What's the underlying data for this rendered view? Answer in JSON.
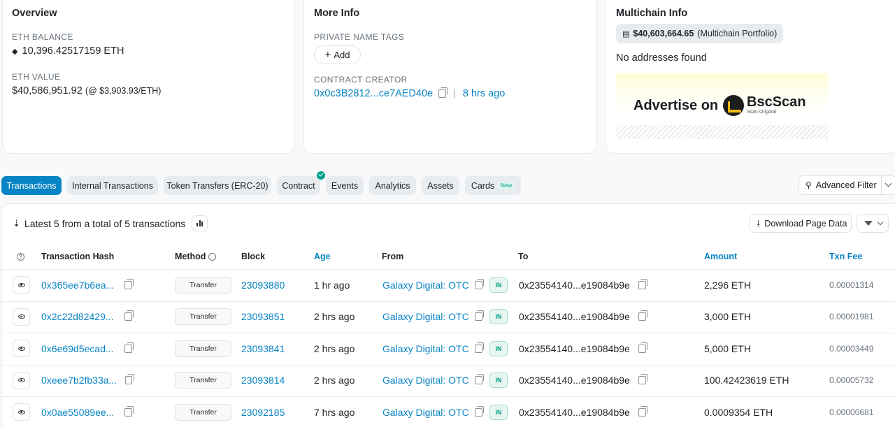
{
  "overview": {
    "title": "Overview",
    "eth_balance_label": "ETH BALANCE",
    "eth_balance": "10,396.42517159 ETH",
    "eth_value_label": "ETH VALUE",
    "eth_value": "$40,586,951.92",
    "eth_value_rate": "(@ $3,903.93/ETH)"
  },
  "more_info": {
    "title": "More Info",
    "name_tags_label": "PRIVATE NAME TAGS",
    "add_label": "Add",
    "contract_creator_label": "CONTRACT CREATOR",
    "creator_address": "0x0c3B2812...ce7AED40e",
    "separator": "|",
    "creator_age": "8 hrs ago"
  },
  "multichain": {
    "title": "Multichain Info",
    "portfolio_value": "$40,603,664.65",
    "portfolio_suffix": "(Multichain Portfolio)",
    "no_addresses": "No addresses found"
  },
  "ad": {
    "text": "Advertise on",
    "brand": "BscScan",
    "brand_sub": "Scan Original"
  },
  "tabs": [
    {
      "label": "Transactions",
      "active": true
    },
    {
      "label": "Internal Transactions"
    },
    {
      "label": "Token Transfers (ERC-20)"
    },
    {
      "label": "Contract"
    },
    {
      "label": "Events"
    },
    {
      "label": "Analytics"
    },
    {
      "label": "Assets"
    },
    {
      "label": "Cards",
      "badge": "New"
    }
  ],
  "advanced_filter_label": "Advanced Filter",
  "table": {
    "summary": "Latest 5 from a total of 5 transactions",
    "download_label": "Download Page Data",
    "headers": {
      "hash": "Transaction Hash",
      "method": "Method",
      "block": "Block",
      "age": "Age",
      "from": "From",
      "to": "To",
      "amount": "Amount",
      "fee": "Txn Fee"
    },
    "rows": [
      {
        "hash": "0x365ee7b6ea...",
        "method": "Transfer",
        "block": "23093880",
        "age": "1 hr ago",
        "from": "Galaxy Digital: OTC",
        "direction": "IN",
        "to": "0x23554140...e19084b9e",
        "amount": "2,296 ETH",
        "fee": "0.00001314"
      },
      {
        "hash": "0x2c22d82429...",
        "method": "Transfer",
        "block": "23093851",
        "age": "2 hrs ago",
        "from": "Galaxy Digital: OTC",
        "direction": "IN",
        "to": "0x23554140...e19084b9e",
        "amount": "3,000 ETH",
        "fee": "0.00001981"
      },
      {
        "hash": "0x6e69d5ecad...",
        "method": "Transfer",
        "block": "23093841",
        "age": "2 hrs ago",
        "from": "Galaxy Digital: OTC",
        "direction": "IN",
        "to": "0x23554140...e19084b9e",
        "amount": "5,000 ETH",
        "fee": "0.00003449"
      },
      {
        "hash": "0xeee7b2fb33a...",
        "method": "Transfer",
        "block": "23093814",
        "age": "2 hrs ago",
        "from": "Galaxy Digital: OTC",
        "direction": "IN",
        "to": "0x23554140...e19084b9e",
        "amount": "100.42423619 ETH",
        "fee": "0.00005732"
      },
      {
        "hash": "0x0ae55089ee...",
        "method": "Transfer",
        "block": "23092185",
        "age": "7 hrs ago",
        "from": "Galaxy Digital: OTC",
        "direction": "IN",
        "to": "0x23554140...e19084b9e",
        "amount": "0.0009354 ETH",
        "fee": "0.00000681"
      }
    ]
  },
  "colors": {
    "accent": "#0784c3",
    "in_badge": "#00a186"
  }
}
